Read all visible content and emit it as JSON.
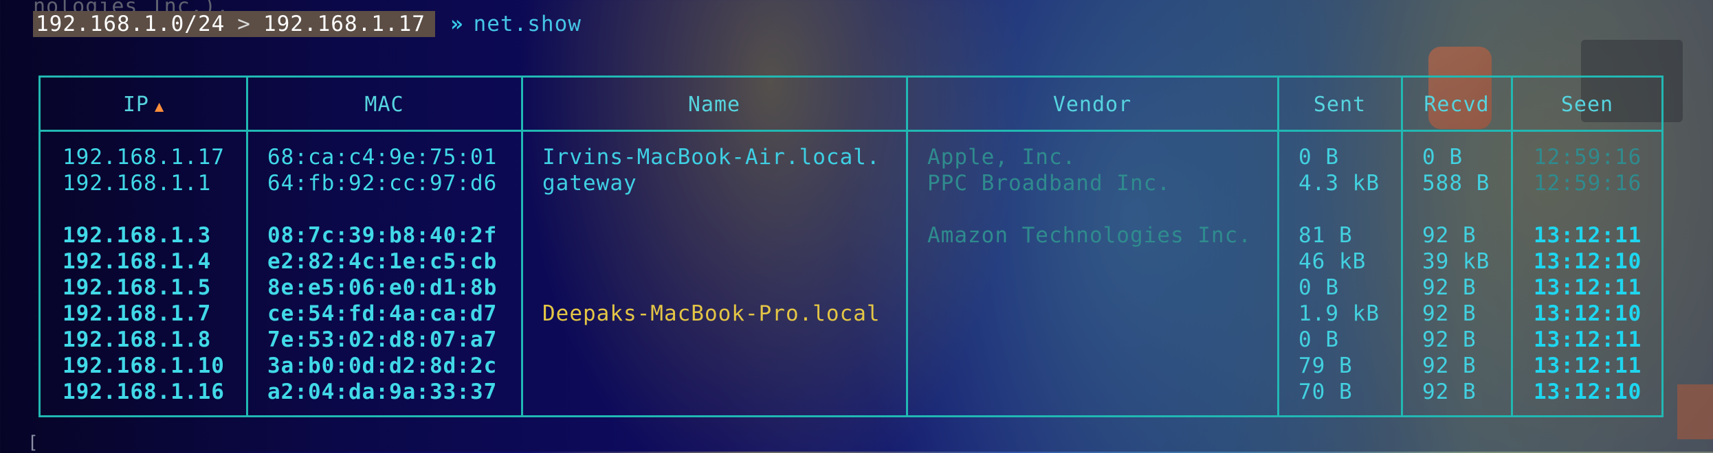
{
  "terminal": {
    "fragment_top": "nologies Inc.).",
    "prompt": {
      "subnet": "192.168.1.0/24",
      "separator": ">",
      "host": "192.168.1.17",
      "arrow": "»",
      "command": "net.show"
    },
    "cursor": "["
  },
  "table": {
    "headers": {
      "ip": "IP",
      "ip_sort": "▲",
      "mac": "MAC",
      "name": "Name",
      "vendor": "Vendor",
      "sent": "Sent",
      "recvd": "Recvd",
      "seen": "Seen"
    },
    "rows": [
      {
        "ip": "192.168.1.17",
        "mac": "68:ca:c4:9e:75:01",
        "name": "Irvins-MacBook-Air.local.",
        "vendor": "Apple, Inc.",
        "sent": "0 B",
        "recvd": "0 B",
        "seen": "12:59:16"
      },
      {
        "ip": "192.168.1.1",
        "mac": "64:fb:92:cc:97:d6",
        "name": "gateway",
        "vendor": "PPC Broadband Inc.",
        "sent": "4.3 kB",
        "recvd": "588 B",
        "seen": "12:59:16"
      },
      {
        "ip": "192.168.1.3",
        "mac": "08:7c:39:b8:40:2f",
        "name": "",
        "vendor": "Amazon Technologies Inc.",
        "sent": "81 B",
        "recvd": "92 B",
        "seen": "13:12:11"
      },
      {
        "ip": "192.168.1.4",
        "mac": "e2:82:4c:1e:c5:cb",
        "name": "",
        "vendor": "",
        "sent": "46 kB",
        "recvd": "39 kB",
        "seen": "13:12:10"
      },
      {
        "ip": "192.168.1.5",
        "mac": "8e:e5:06:e0:d1:8b",
        "name": "",
        "vendor": "",
        "sent": "0 B",
        "recvd": "92 B",
        "seen": "13:12:11"
      },
      {
        "ip": "192.168.1.7",
        "mac": "ce:54:fd:4a:ca:d7",
        "name": "Deepaks-MacBook-Pro.local",
        "vendor": "",
        "sent": "1.9 kB",
        "recvd": "92 B",
        "seen": "13:12:10"
      },
      {
        "ip": "192.168.1.8",
        "mac": "7e:53:02:d8:07:a7",
        "name": "",
        "vendor": "",
        "sent": "0 B",
        "recvd": "92 B",
        "seen": "13:12:11"
      },
      {
        "ip": "192.168.1.10",
        "mac": "3a:b0:0d:d2:8d:2c",
        "name": "",
        "vendor": "",
        "sent": "79 B",
        "recvd": "92 B",
        "seen": "13:12:11"
      },
      {
        "ip": "192.168.1.16",
        "mac": "a2:04:da:9a:33:37",
        "name": "",
        "vendor": "",
        "sent": "70 B",
        "recvd": "92 B",
        "seen": "13:12:10"
      }
    ]
  },
  "colors": {
    "border": "#21b8b3",
    "header_text": "#56d4df",
    "sort_arrow": "#ff8f3a",
    "cyan_text": "#41d9e8",
    "dim_text": "#2f8b8e",
    "highlight_name": "#e4c645",
    "prompt_box": "#5c4e45"
  }
}
